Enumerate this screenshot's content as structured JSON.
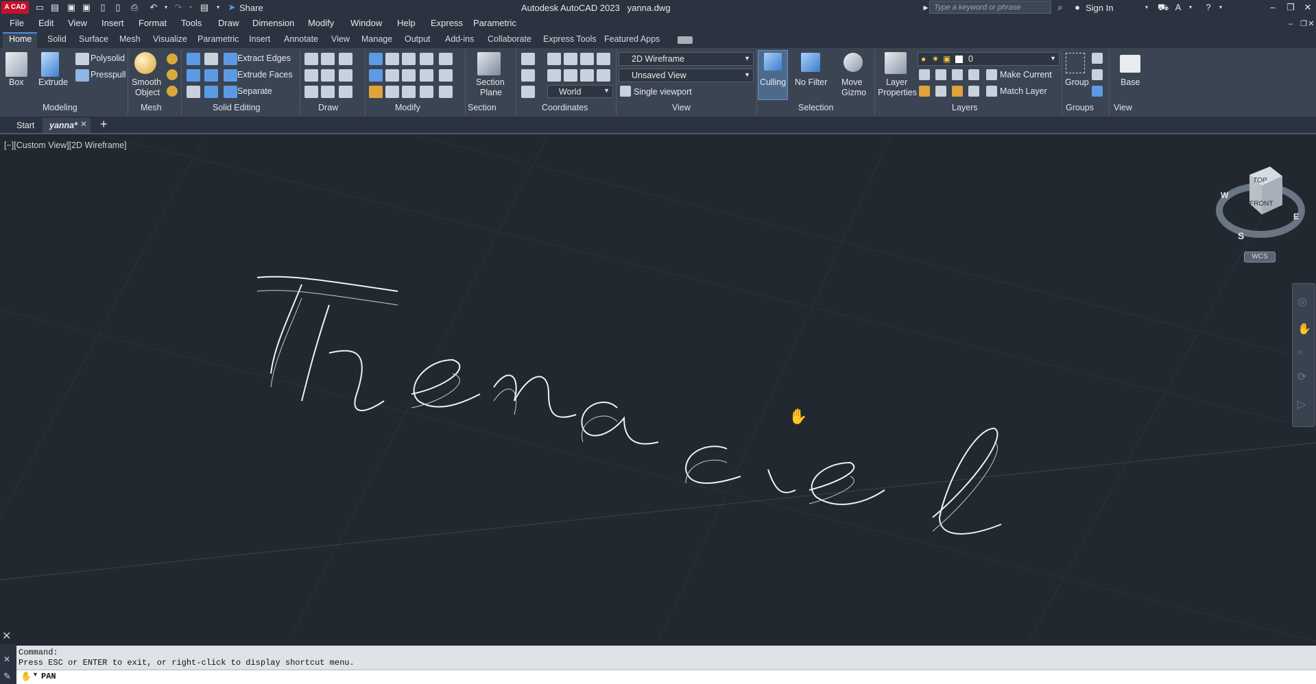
{
  "app": {
    "logo": "A CAD",
    "title": "Autodesk AutoCAD 2023",
    "filename": "yanna.dwg",
    "share_label": "Share",
    "search_placeholder": "Type a keyword or phrase",
    "sign_in": "Sign In"
  },
  "menu": [
    "File",
    "Edit",
    "View",
    "Insert",
    "Format",
    "Tools",
    "Draw",
    "Dimension",
    "Modify",
    "Window",
    "Help",
    "Express",
    "Parametric"
  ],
  "ribbon_tabs": [
    "Home",
    "Solid",
    "Surface",
    "Mesh",
    "Visualize",
    "Parametric",
    "Insert",
    "Annotate",
    "View",
    "Manage",
    "Output",
    "Add-ins",
    "Collaborate",
    "Express Tools",
    "Featured Apps"
  ],
  "ribbon": {
    "modeling": {
      "box": "Box",
      "extrude": "Extrude",
      "polysolid": "Polysolid",
      "presspull": "Presspull",
      "label": "Modeling"
    },
    "mesh": {
      "smooth1": "Smooth",
      "smooth2": "Object",
      "label": "Mesh"
    },
    "solid_editing": {
      "extract_edges": "Extract Edges",
      "extrude_faces": "Extrude Faces",
      "separate": "Separate",
      "label": "Solid Editing"
    },
    "draw": {
      "label": "Draw"
    },
    "modify": {
      "label": "Modify"
    },
    "section": {
      "line1": "Section",
      "line2": "Plane",
      "label": "Section"
    },
    "coordinates": {
      "world": "World",
      "label": "Coordinates"
    },
    "view": {
      "visual_style": "2D Wireframe",
      "named_view": "Unsaved View",
      "viewport": "Single viewport",
      "label": "View"
    },
    "selection": {
      "culling": "Culling",
      "no_filter": "No Filter",
      "move1": "Move",
      "move2": "Gizmo",
      "label": "Selection"
    },
    "layers": {
      "props1": "Layer",
      "props2": "Properties",
      "layer_value": "0",
      "make_current": "Make Current",
      "match_layer": "Match Layer",
      "label": "Layers"
    },
    "groups": {
      "group": "Group",
      "label": "Groups"
    },
    "viewpanel": {
      "base": "Base",
      "label": "View"
    }
  },
  "file_tabs": {
    "start": "Start",
    "doc": "yanna*",
    "add": "+"
  },
  "viewport": {
    "label": "[−][Custom View][2D Wireframe]",
    "viewcube": {
      "top": "TOP",
      "front": "FRONT",
      "w": "W",
      "e": "E",
      "s": "S",
      "wcs": "WCS"
    },
    "drawn_text": "Themaciel"
  },
  "command": {
    "line1": "Command:",
    "line2": "Press ESC or ENTER to exit, or right-click to display shortcut menu.",
    "current": "PAN"
  },
  "colors": {
    "accent": "#4f8fe0",
    "ribbon_bg": "#3b4453",
    "canvas": "#212830",
    "logo": "#c8102e"
  }
}
